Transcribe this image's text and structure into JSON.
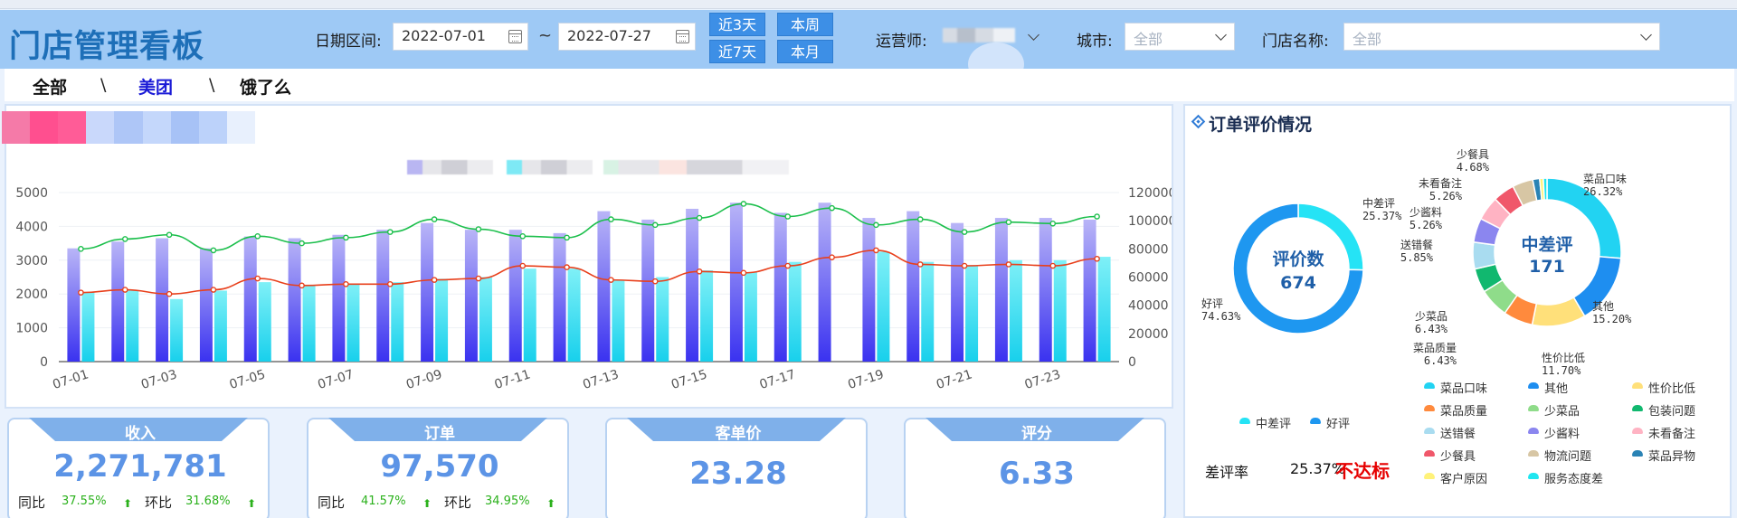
{
  "app_title": "门店管理看板",
  "filters": {
    "date_label": "日期区间:",
    "date_start": "2022-07-01",
    "date_sep": "~",
    "date_end": "2022-07-27",
    "quick": [
      "近3天",
      "本周",
      "近7天",
      "本月"
    ],
    "operator_label": "运营师:",
    "city_label": "城市:",
    "city_value": "全部",
    "store_label": "门店名称:",
    "store_value": "全部"
  },
  "platform_tabs": {
    "items": [
      "全部",
      "美团",
      "饿了么"
    ],
    "separator": "\\",
    "active": "美团"
  },
  "chart_data": {
    "type": "bar",
    "categories": [
      "07-01",
      "07-02",
      "07-03",
      "07-04",
      "07-05",
      "07-06",
      "07-07",
      "07-08",
      "07-09",
      "07-10",
      "07-11",
      "07-12",
      "07-13",
      "07-14",
      "07-15",
      "07-16",
      "07-17",
      "07-18",
      "07-19",
      "07-20",
      "07-21",
      "07-22",
      "07-23",
      "07-24"
    ],
    "tick_labels": [
      "07-01",
      "07-03",
      "07-05",
      "07-07",
      "07-09",
      "07-11",
      "07-13",
      "07-15",
      "07-17",
      "07-19",
      "07-21",
      "07-23"
    ],
    "ylim_left": [
      0,
      5000
    ],
    "yticks_left": [
      0,
      1000,
      2000,
      3000,
      4000,
      5000
    ],
    "ylim_right": [
      0,
      120000
    ],
    "yticks_right": [
      0,
      20000,
      40000,
      60000,
      80000,
      100000,
      120000
    ],
    "series": [
      {
        "type": "bar",
        "axis": "left",
        "color": "#8a8ff5",
        "values": [
          3350,
          3550,
          3650,
          3350,
          3700,
          3650,
          3750,
          3900,
          4100,
          3900,
          3900,
          3800,
          4450,
          4200,
          4520,
          4700,
          4400,
          4700,
          4250,
          4450,
          4100,
          4250,
          4250,
          4200
        ]
      },
      {
        "type": "bar",
        "axis": "left",
        "color": "#39dcf2",
        "values": [
          2050,
          2100,
          1850,
          2100,
          2350,
          2250,
          2300,
          2350,
          2450,
          2500,
          2750,
          2750,
          2400,
          2500,
          2700,
          2650,
          2950,
          0,
          3250,
          2950,
          2850,
          3000,
          3000,
          3100
        ]
      },
      {
        "type": "line",
        "axis": "right",
        "color": "#1cbf4c",
        "values": [
          80000,
          87000,
          90000,
          79000,
          89000,
          84000,
          88000,
          92000,
          101000,
          94000,
          89000,
          88000,
          101000,
          97000,
          102000,
          112000,
          103000,
          109000,
          97000,
          101000,
          92000,
          99000,
          98000,
          103000
        ]
      },
      {
        "type": "line",
        "axis": "right",
        "color": "#e8401c",
        "values": [
          49000,
          51000,
          48000,
          51000,
          59000,
          54000,
          55000,
          55000,
          58000,
          59000,
          68000,
          67000,
          58000,
          57000,
          64000,
          63000,
          68000,
          74000,
          79000,
          69000,
          68000,
          69000,
          68000,
          73000
        ]
      }
    ]
  },
  "kpis": [
    {
      "title": "收入",
      "value": "2,271,781",
      "yoy_label": "同比",
      "yoy": "37.55%",
      "mom_label": "环比",
      "mom": "31.68%"
    },
    {
      "title": "订单",
      "value": "97,570",
      "yoy_label": "同比",
      "yoy": "41.57%",
      "mom_label": "环比",
      "mom": "34.95%"
    },
    {
      "title": "客单价",
      "value": "23.28"
    },
    {
      "title": "评分",
      "value": "6.33"
    }
  ],
  "review": {
    "title": "订单评价情况",
    "donut1": {
      "center_label": "评价数",
      "center_value": "674",
      "slices": [
        {
          "name": "中差评",
          "percent": "25.37%",
          "value": 25.37,
          "color": "#25e3f5"
        },
        {
          "name": "好评",
          "percent": "74.63%",
          "value": 74.63,
          "color": "#1e97f0"
        }
      ]
    },
    "donut2": {
      "center_label": "中差评",
      "center_value": "171",
      "slices": [
        {
          "name": "菜品口味",
          "percent": "26.32%",
          "value": 26.32,
          "color": "#22d3f2"
        },
        {
          "name": "其他",
          "percent": "15.20%",
          "value": 15.2,
          "color": "#1e8ef0"
        },
        {
          "name": "性价比低",
          "percent": "11.70%",
          "value": 11.7,
          "color": "#ffe07a"
        },
        {
          "name": "菜品质量",
          "percent": "6.43%",
          "value": 6.43,
          "color": "#ff8a3d"
        },
        {
          "name": "少菜品",
          "percent": "6.43%",
          "value": 6.43,
          "color": "#8fdc8a"
        },
        {
          "name": "包装问题",
          "percent": "",
          "value": 5.26,
          "color": "#11b86f"
        },
        {
          "name": "送错餐",
          "percent": "5.85%",
          "value": 5.85,
          "color": "#a9dcf0"
        },
        {
          "name": "少酱料",
          "percent": "5.26%",
          "value": 5.26,
          "color": "#8b86ef"
        },
        {
          "name": "未看备注",
          "percent": "5.26%",
          "value": 5.26,
          "color": "#ffb3c3"
        },
        {
          "name": "少餐具",
          "percent": "4.68%",
          "value": 4.68,
          "color": "#f0576a"
        },
        {
          "name": "物流问题",
          "percent": "",
          "value": 4.5,
          "color": "#d7c6a4"
        },
        {
          "name": "菜品异物",
          "percent": "",
          "value": 1.5,
          "color": "#2a83b5"
        },
        {
          "name": "客户原因",
          "percent": "",
          "value": 0.8,
          "color": "#fff27a"
        },
        {
          "name": "服务态度差",
          "percent": "",
          "value": 0.8,
          "color": "#1fe6f0"
        }
      ]
    },
    "legend1": [
      "中差评",
      "好评"
    ],
    "bad_rate_label": "差评率",
    "bad_rate_value": "25.37%",
    "bad_rate_status": "不达标"
  }
}
